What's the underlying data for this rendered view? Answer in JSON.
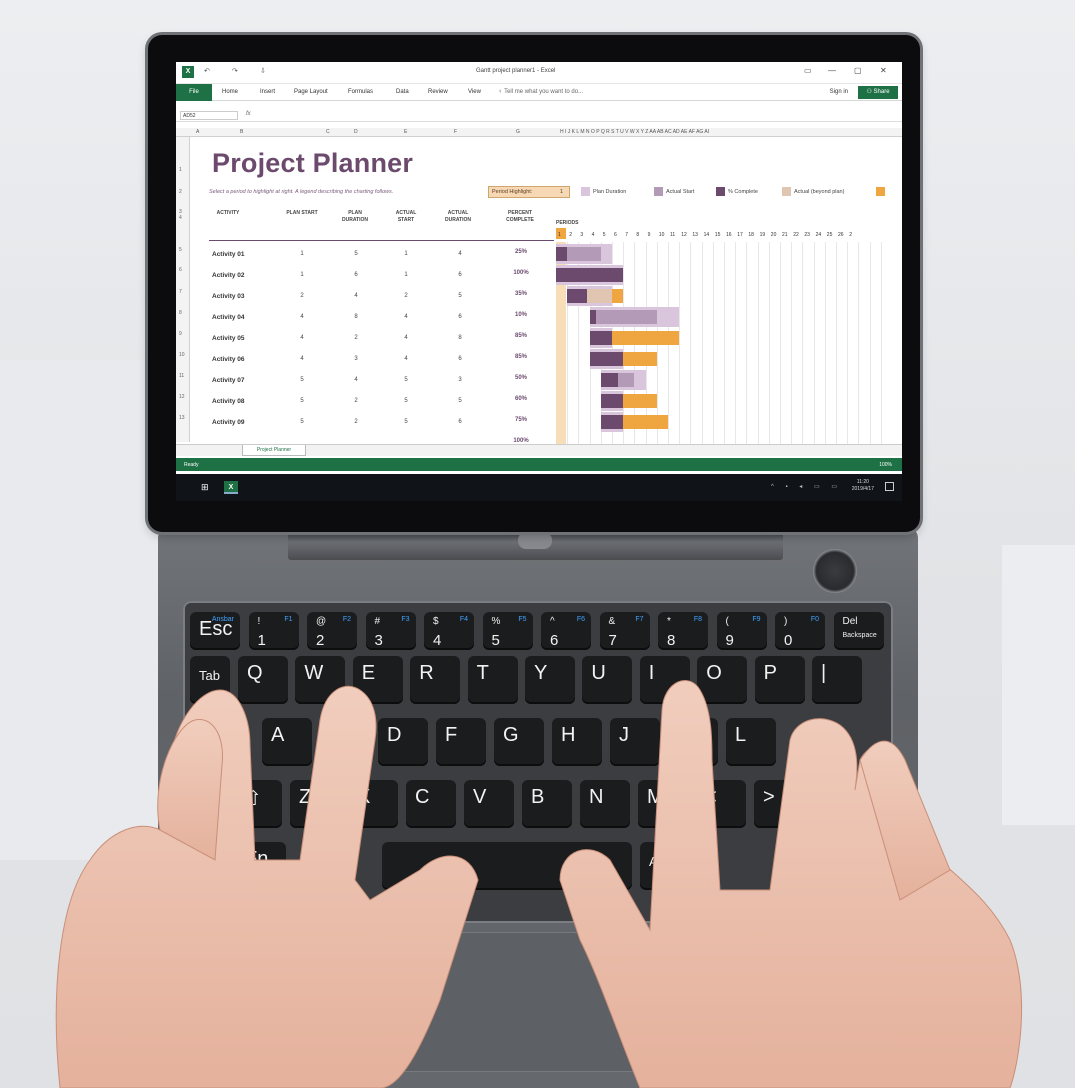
{
  "excel": {
    "window_title": "Gantt project planner1 - Excel",
    "app_icon": "excel-icon",
    "qat_items": [
      "↶",
      "↷",
      "⇩"
    ],
    "window_controls": [
      "▭",
      "—",
      "▢",
      "✕"
    ],
    "ribbon_tabs": [
      "Home",
      "Insert",
      "Page Layout",
      "Formulas",
      "Data",
      "Review",
      "View"
    ],
    "file_label": "File",
    "tell_me": "Tell me what you want to do...",
    "sign_in": "Sign in",
    "share": "Share",
    "name_box": "AD52",
    "fx": "fx",
    "column_headers": [
      "A",
      "B",
      "C",
      "D",
      "E",
      "F",
      "G",
      "H I J K L M N O P Q R S T U V W X Y Z AA AB AC AD AE AF AG AI"
    ],
    "row_numbers": [
      "1",
      "2",
      "3",
      "4",
      "5",
      "6",
      "7",
      "8",
      "9",
      "10",
      "11",
      "12",
      "13"
    ],
    "sheet": {
      "title": "Project Planner",
      "subtitle": "Select a period to highlight at right.  A legend describing the charting follows.",
      "period_highlight_label": "Period Highlight:",
      "period_highlight_value": "1",
      "legend": [
        {
          "label": "Plan Duration",
          "color": "#d9c6dc"
        },
        {
          "label": "Actual Start",
          "color": "#b39ab6"
        },
        {
          "label": "% Complete",
          "color": "#6b4a6d"
        },
        {
          "label": "Actual (beyond plan)",
          "color": "#e0c5b0"
        },
        {
          "label": "",
          "color": "#f0a640"
        }
      ],
      "headers": {
        "activity": "ACTIVITY",
        "plan_start": "PLAN START",
        "plan_duration": "PLAN DURATION",
        "actual_start": "ACTUAL START",
        "actual_duration": "ACTUAL DURATION",
        "percent_complete": "PERCENT COMPLETE",
        "periods": "PERIODS"
      },
      "period_numbers": [
        "1",
        "2",
        "3",
        "4",
        "5",
        "6",
        "7",
        "8",
        "9",
        "10",
        "11",
        "12",
        "13",
        "14",
        "15",
        "16",
        "17",
        "18",
        "19",
        "20",
        "21",
        "22",
        "23",
        "24",
        "25",
        "26",
        "2"
      ],
      "activities": [
        {
          "name": "Activity 01",
          "plan_start": "1",
          "plan_duration": "5",
          "actual_start": "1",
          "actual_duration": "4",
          "percent": "25%"
        },
        {
          "name": "Activity 02",
          "plan_start": "1",
          "plan_duration": "6",
          "actual_start": "1",
          "actual_duration": "6",
          "percent": "100%"
        },
        {
          "name": "Activity 03",
          "plan_start": "2",
          "plan_duration": "4",
          "actual_start": "2",
          "actual_duration": "5",
          "percent": "35%"
        },
        {
          "name": "Activity 04",
          "plan_start": "4",
          "plan_duration": "8",
          "actual_start": "4",
          "actual_duration": "6",
          "percent": "10%"
        },
        {
          "name": "Activity 05",
          "plan_start": "4",
          "plan_duration": "2",
          "actual_start": "4",
          "actual_duration": "8",
          "percent": "85%"
        },
        {
          "name": "Activity 06",
          "plan_start": "4",
          "plan_duration": "3",
          "actual_start": "4",
          "actual_duration": "6",
          "percent": "85%"
        },
        {
          "name": "Activity 07",
          "plan_start": "5",
          "plan_duration": "4",
          "actual_start": "5",
          "actual_duration": "3",
          "percent": "50%"
        },
        {
          "name": "Activity 08",
          "plan_start": "5",
          "plan_duration": "2",
          "actual_start": "5",
          "actual_duration": "5",
          "percent": "60%"
        },
        {
          "name": "Activity 09",
          "plan_start": "5",
          "plan_duration": "2",
          "actual_start": "5",
          "actual_duration": "6",
          "percent": "75%"
        }
      ],
      "partial_last_percent": "100%"
    },
    "sheet_tab": "Project Planner",
    "status_ready": "Ready",
    "zoom": "100%"
  },
  "taskbar": {
    "start_icon": "windows-start-icon",
    "app_icon": "excel-taskbar-icon",
    "tray": "^ ▪ ◂ ▭ ▭",
    "time": "11:20",
    "date": "2019/4/17"
  },
  "keyboard": {
    "row1": [
      {
        "main": "Esc",
        "fn": "Ansbar"
      },
      {
        "main": "1",
        "top": "!",
        "fn": "F1"
      },
      {
        "main": "2",
        "top": "@",
        "fn": "F2"
      },
      {
        "main": "3",
        "top": "#",
        "fn": "F3"
      },
      {
        "main": "4",
        "top": "$",
        "fn": "F4"
      },
      {
        "main": "5",
        "top": "%",
        "fn": "F5"
      },
      {
        "main": "6",
        "top": "^",
        "fn": "F6"
      },
      {
        "main": "7",
        "top": "&",
        "fn": "F7"
      },
      {
        "main": "8",
        "top": "*",
        "fn": "F8"
      },
      {
        "main": "9",
        "top": "(",
        "fn": "F9"
      },
      {
        "main": "0",
        "top": ")",
        "fn": "F0"
      },
      {
        "main": "Backspace",
        "top": "Del",
        "fn": ""
      }
    ],
    "row2": [
      "Tab",
      "Q",
      "W",
      "E",
      "R",
      "T",
      "Y",
      "U",
      "I",
      "O",
      "P",
      "|"
    ],
    "row3": [
      "A",
      "S",
      "D",
      "F",
      "G",
      "H",
      "J",
      "K",
      "L"
    ],
    "row4": [
      "⇧",
      "Z",
      "X",
      "C",
      "V",
      "B",
      "N",
      "M",
      "<",
      ">"
    ],
    "row5": [
      "Fn",
      "",
      "Alt"
    ]
  }
}
